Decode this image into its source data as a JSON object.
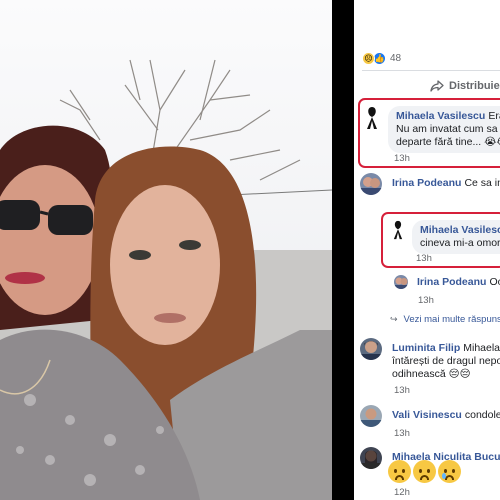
{
  "post": {
    "reaction_count": "48",
    "reaction_icons": [
      "sad-icon",
      "like-icon"
    ],
    "share_label": "Distribuie"
  },
  "comments": [
    {
      "author": "Mihaela Vasilescu",
      "text_lines": [
        "Erai s",
        "Nu am invatat cum sa pot",
        "departe fără tine... 😭😭"
      ],
      "time": "13h",
      "avatar": "black-ribbon"
    },
    {
      "author": "Irina Podeanu",
      "text_lines": [
        "Ce sa inta"
      ],
      "time": "",
      "avatar": "photo"
    },
    {
      "author": "Mihaela Vasilescu",
      "text_lines": [
        "",
        "cineva mi-a omorît c"
      ],
      "time": "13h",
      "avatar": "black-ribbon"
    },
    {
      "author": "Irina Podeanu",
      "text_lines": [
        "Ooc"
      ],
      "time": "13h",
      "avatar": "photo"
    },
    {
      "author": "Luminita Filip",
      "text_lines": [
        "Mihaela tre",
        "întărești de dragul nepoții",
        "odihnească 😔😔"
      ],
      "time": "13h",
      "avatar": "photo"
    },
    {
      "author": "Vali Visinescu",
      "text_lines": [
        "condolea"
      ],
      "time": "13h",
      "avatar": "photo"
    },
    {
      "author": "Mihaela Niculita Bucura",
      "text_lines": [],
      "time": "12h",
      "avatar": "photo"
    }
  ],
  "more_replies_label": "Vezi mai multe răspunsu",
  "colors": {
    "link": "#385898",
    "highlight": "#d6203a",
    "bubble": "#f0f2f5",
    "meta": "#65676b"
  }
}
